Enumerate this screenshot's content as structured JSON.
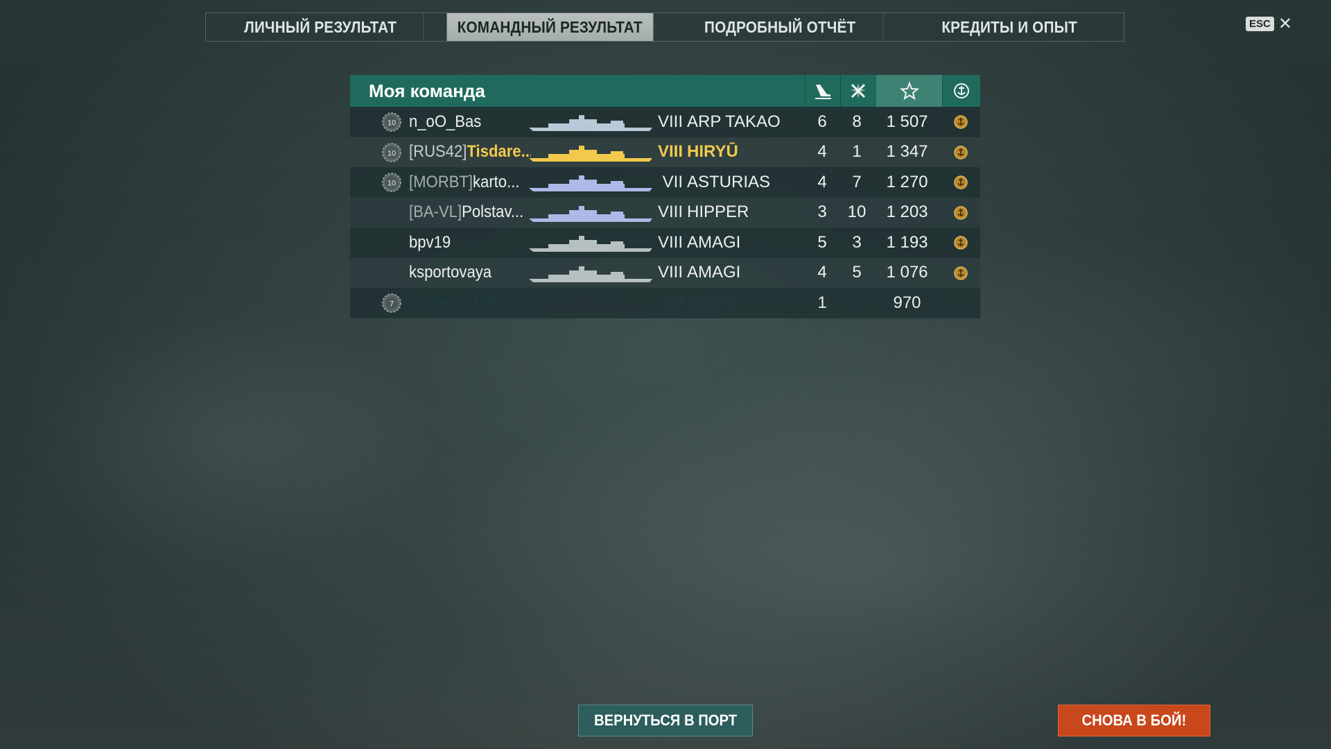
{
  "tabs": [
    {
      "label": "ЛИЧНЫЙ РЕЗУЛЬТАТ",
      "active": false
    },
    {
      "label": "КОМАНДНЫЙ РЕЗУЛЬТАТ",
      "active": true
    },
    {
      "label": "ПОДРОБНЫЙ ОТЧЁТ",
      "active": false
    },
    {
      "label": "КРЕДИТЫ И ОПЫТ",
      "active": false
    }
  ],
  "esc": {
    "key": "ESC",
    "close": "✕"
  },
  "team": {
    "title": "Моя команда",
    "columns": [
      {
        "icon": "ship-sunk-icon"
      },
      {
        "icon": "plane-kill-icon"
      },
      {
        "icon": "star-icon",
        "highlighted": true
      },
      {
        "icon": "anchor-medal-icon"
      }
    ],
    "highlight_color": "#f2c94c",
    "header_color": "#1f6a5d",
    "rows": [
      {
        "level": "10",
        "clan": "",
        "name": "n_oO_Bas",
        "ship_tier": "VIII",
        "ship": "ARP TAKAO",
        "col1": "6",
        "col2": "8",
        "score": "1 507",
        "medal": true,
        "self": false,
        "dead": false
      },
      {
        "level": "10",
        "clan": "[RUS42]",
        "name": "Tisdare...",
        "ship_tier": "VIII",
        "ship": "HIRYŪ",
        "col1": "4",
        "col2": "1",
        "score": "1 347",
        "medal": true,
        "self": true,
        "dead": false
      },
      {
        "level": "10",
        "clan": "[MORBT]",
        "name": "karto...",
        "ship_tier": "VII",
        "ship": "ASTURIAS",
        "col1": "4",
        "col2": "7",
        "score": "1 270",
        "medal": true,
        "self": false,
        "dead": false
      },
      {
        "level": "",
        "clan": "[BA-VL]",
        "name": "Polstav...",
        "ship_tier": "VIII",
        "ship": "HIPPER",
        "col1": "3",
        "col2": "10",
        "score": "1 203",
        "medal": true,
        "self": false,
        "dead": false
      },
      {
        "level": "",
        "clan": "",
        "name": "bpv19",
        "ship_tier": "VIII",
        "ship": "AMAGI",
        "col1": "5",
        "col2": "3",
        "score": "1 193",
        "medal": true,
        "self": false,
        "dead": false
      },
      {
        "level": "",
        "clan": "",
        "name": "ksportovaya",
        "ship_tier": "VIII",
        "ship": "AMAGI",
        "col1": "4",
        "col2": "5",
        "score": "1 076",
        "medal": true,
        "self": false,
        "dead": false
      },
      {
        "level": "7",
        "clan": "",
        "name": "andreyka108",
        "ship_tier": "VII",
        "ship": "ЩОРС",
        "col1": "1",
        "col2": "",
        "score": "970",
        "medal": false,
        "self": false,
        "dead": true
      }
    ]
  },
  "buttons": {
    "port": "ВЕРНУТЬСЯ В ПОРТ",
    "battle": "СНОВА В БОЙ!",
    "battle_color": "#c8471b"
  }
}
